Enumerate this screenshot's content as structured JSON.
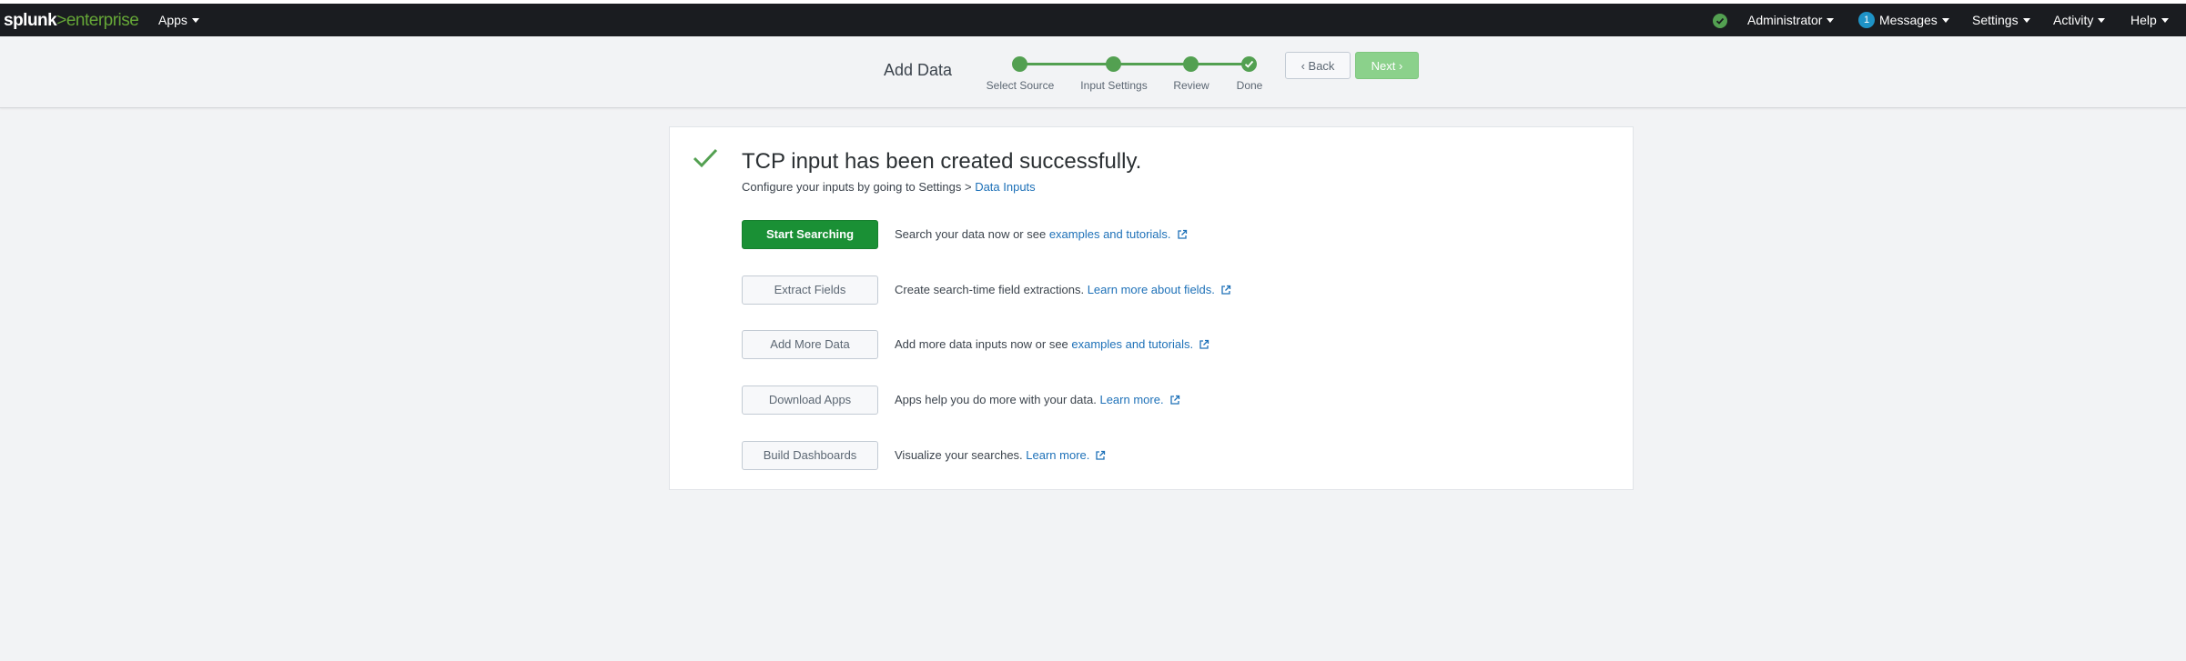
{
  "navbar": {
    "logo_splunk": "splunk",
    "logo_gt": ">",
    "logo_enterprise": "enterprise",
    "apps_label": "Apps",
    "admin_label": "Administrator",
    "messages_count": "1",
    "messages_label": "Messages",
    "settings_label": "Settings",
    "activity_label": "Activity",
    "help_label": "Help"
  },
  "wizard": {
    "title": "Add Data",
    "steps": [
      {
        "label": "Select Source"
      },
      {
        "label": "Input Settings"
      },
      {
        "label": "Review"
      },
      {
        "label": "Done"
      }
    ],
    "back_label": "‹ Back",
    "next_label": "Next ›"
  },
  "result": {
    "title": "TCP input has been created successfully.",
    "subtitle_prefix": "Configure your inputs by going to Settings > ",
    "subtitle_link": "Data Inputs",
    "actions": [
      {
        "button": "Start Searching",
        "text": "Search your data now or see ",
        "link": "examples and tutorials."
      },
      {
        "button": "Extract Fields",
        "text": "Create search-time field extractions. ",
        "link": "Learn more about fields."
      },
      {
        "button": "Add More Data",
        "text": "Add more data inputs now or see ",
        "link": "examples and tutorials."
      },
      {
        "button": "Download Apps",
        "text": "Apps help you do more with your data. ",
        "link": "Learn more."
      },
      {
        "button": "Build Dashboards",
        "text": "Visualize your searches. ",
        "link": "Learn more."
      }
    ]
  },
  "colors": {
    "navbar_bg": "#1a1c20",
    "brand_green": "#65a637",
    "success_green": "#53a051",
    "primary_button": "#1a9035",
    "link_blue": "#1e71b8"
  }
}
